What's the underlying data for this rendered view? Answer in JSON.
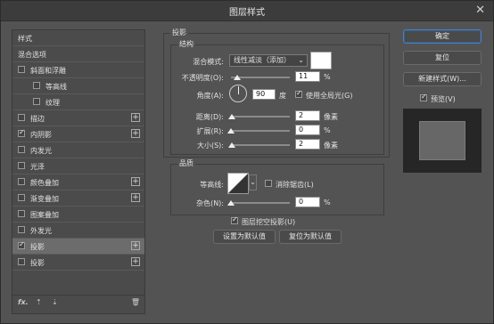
{
  "window": {
    "title": "图层样式",
    "close_glyph": "✕"
  },
  "left": {
    "items": [
      {
        "label": "样式",
        "checkbox": false,
        "plus": false,
        "indent": false
      },
      {
        "label": "混合选项",
        "checkbox": false,
        "plus": false,
        "indent": false
      },
      {
        "label": "斜面和浮雕",
        "checkbox": true,
        "checked": false,
        "plus": false,
        "indent": false
      },
      {
        "label": "等高线",
        "checkbox": true,
        "checked": false,
        "plus": false,
        "indent": true
      },
      {
        "label": "纹理",
        "checkbox": true,
        "checked": false,
        "plus": false,
        "indent": true
      },
      {
        "label": "描边",
        "checkbox": true,
        "checked": false,
        "plus": true,
        "indent": false
      },
      {
        "label": "内阴影",
        "checkbox": true,
        "checked": true,
        "plus": true,
        "indent": false
      },
      {
        "label": "内发光",
        "checkbox": true,
        "checked": false,
        "plus": false,
        "indent": false
      },
      {
        "label": "光泽",
        "checkbox": true,
        "checked": false,
        "plus": false,
        "indent": false
      },
      {
        "label": "颜色叠加",
        "checkbox": true,
        "checked": false,
        "plus": true,
        "indent": false
      },
      {
        "label": "渐变叠加",
        "checkbox": true,
        "checked": false,
        "plus": true,
        "indent": false
      },
      {
        "label": "图案叠加",
        "checkbox": true,
        "checked": false,
        "plus": false,
        "indent": false
      },
      {
        "label": "外发光",
        "checkbox": true,
        "checked": false,
        "plus": false,
        "indent": false
      },
      {
        "label": "投影",
        "checkbox": true,
        "checked": true,
        "plus": true,
        "indent": false,
        "selected": true
      },
      {
        "label": "投影",
        "checkbox": true,
        "checked": false,
        "plus": true,
        "indent": false
      }
    ],
    "footer": {
      "fx": "fx.",
      "up": "⇡",
      "down": "⇣",
      "trash": "🗑"
    },
    "plus_glyph": "+"
  },
  "shadow": {
    "section_title": "投影",
    "struct_title": "结构",
    "blend_label": "混合模式:",
    "blend_value": "线性减淡（添加）",
    "opacity_label": "不透明度(O):",
    "opacity_value": "11",
    "percent": "%",
    "angle_label": "角度(A):",
    "angle_value": "90",
    "angle_unit": "度",
    "global_light_label": "使用全局光(G)",
    "distance_label": "距离(D):",
    "distance_value": "2",
    "px": "像素",
    "spread_label": "扩展(R):",
    "spread_value": "0",
    "size_label": "大小(S):",
    "size_value": "2",
    "quality_title": "品质",
    "contour_label": "等高线:",
    "antialias_label": "消除锯齿(L)",
    "noise_label": "杂色(N):",
    "noise_value": "0",
    "knockout_label": "图层挖空投影(U)",
    "default_btn": "设置为默认值",
    "reset_default_btn": "复位为默认值",
    "sliders": {
      "opacity": 0.11,
      "distance": 0.02,
      "spread": 0.0,
      "size": 0.02,
      "noise": 0.0
    }
  },
  "right": {
    "ok": "确定",
    "reset": "复位",
    "new_style": "新建样式(W)...",
    "preview_label": "预览(V)"
  },
  "colors": {
    "blend_swatch": "#ffffff"
  }
}
